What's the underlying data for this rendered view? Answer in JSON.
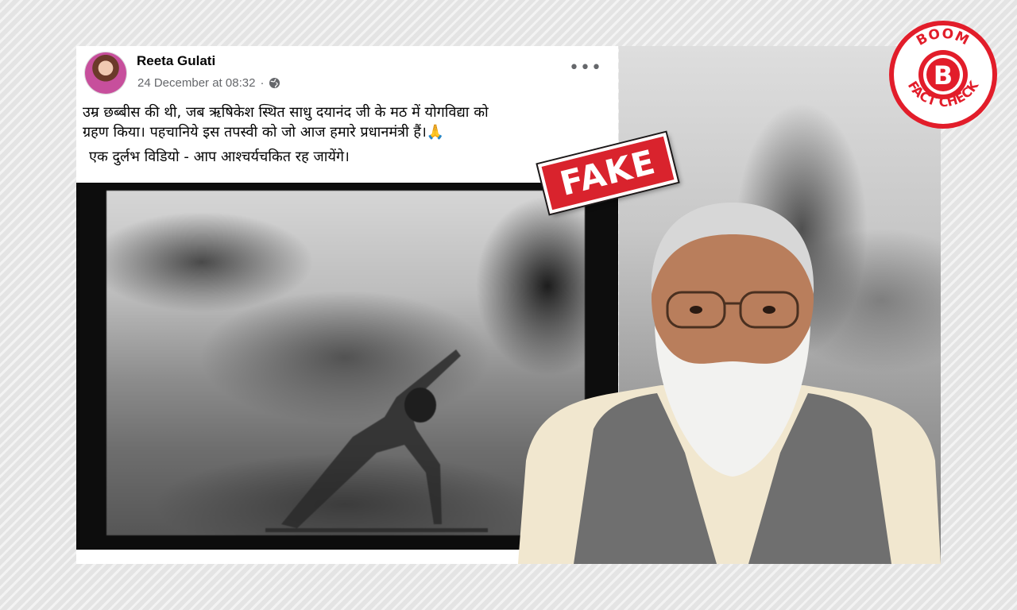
{
  "post": {
    "author": "Reeta Gulati",
    "timestamp": "24 December at 08:32",
    "audience_icon": "globe-icon",
    "more_icon": "more-options-icon",
    "text_line1": "उम्र छब्बीस की थी, जब ऋषिकेश स्थित साधु दयानंद जी के मठ में योगविद्या को",
    "text_line2": "ग्रहण किया। पहचानिये इस तपस्वी को जो आज हमारे प्रधानमंत्री हैं।🙏",
    "text_line3": "एक दुर्लभ विडियो - आप आश्चर्यचकित    रह जायेंगे।"
  },
  "stamp": {
    "label": "FAKE"
  },
  "logo": {
    "top_text": "BOOM",
    "letter": "B",
    "bottom_text": "FACT CHECK"
  },
  "colors": {
    "stamp_red": "#d9232d",
    "logo_red": "#e21d2a",
    "text_primary": "#050505",
    "text_secondary": "#65676b"
  }
}
